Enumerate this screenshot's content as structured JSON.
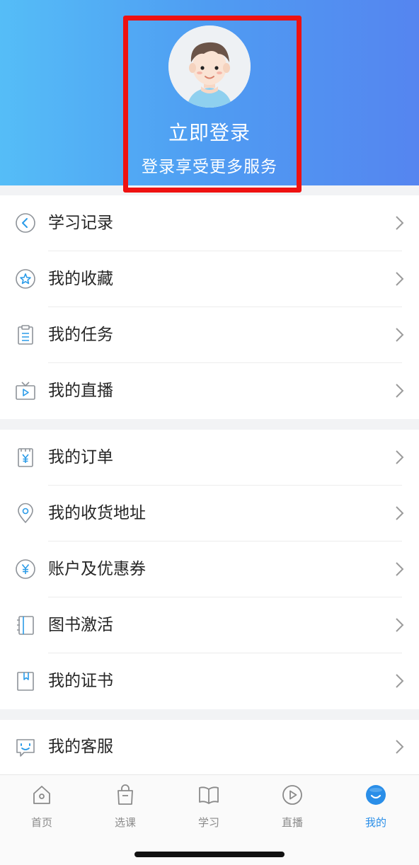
{
  "header": {
    "login_title": "立即登录",
    "login_subtitle": "登录享受更多服务",
    "highlight_color": "#ee1111",
    "gradient": [
      "#55bdf7",
      "#5585f0"
    ]
  },
  "menu_groups": [
    {
      "items": [
        {
          "label": "学习记录",
          "icon": "history-back-icon"
        },
        {
          "label": "我的收藏",
          "icon": "star-icon"
        },
        {
          "label": "我的任务",
          "icon": "clipboard-icon"
        },
        {
          "label": "我的直播",
          "icon": "tv-play-icon"
        }
      ]
    },
    {
      "items": [
        {
          "label": "我的订单",
          "icon": "yen-order-icon"
        },
        {
          "label": "我的收货地址",
          "icon": "location-pin-icon"
        },
        {
          "label": "账户及优惠券",
          "icon": "yen-coin-icon"
        },
        {
          "label": "图书激活",
          "icon": "book-activate-icon"
        },
        {
          "label": "我的证书",
          "icon": "certificate-icon"
        }
      ]
    },
    {
      "items": [
        {
          "label": "我的客服",
          "icon": "customer-service-icon"
        }
      ]
    }
  ],
  "tabbar": {
    "tabs": [
      {
        "label": "首页",
        "icon": "home-icon"
      },
      {
        "label": "选课",
        "icon": "shopping-bag-icon"
      },
      {
        "label": "学习",
        "icon": "open-book-icon"
      },
      {
        "label": "直播",
        "icon": "play-circle-icon"
      },
      {
        "label": "我的",
        "icon": "profile-face-icon",
        "active": true
      }
    ],
    "active_color": "#2a8ee8",
    "inactive_color": "#8a8a8a"
  }
}
